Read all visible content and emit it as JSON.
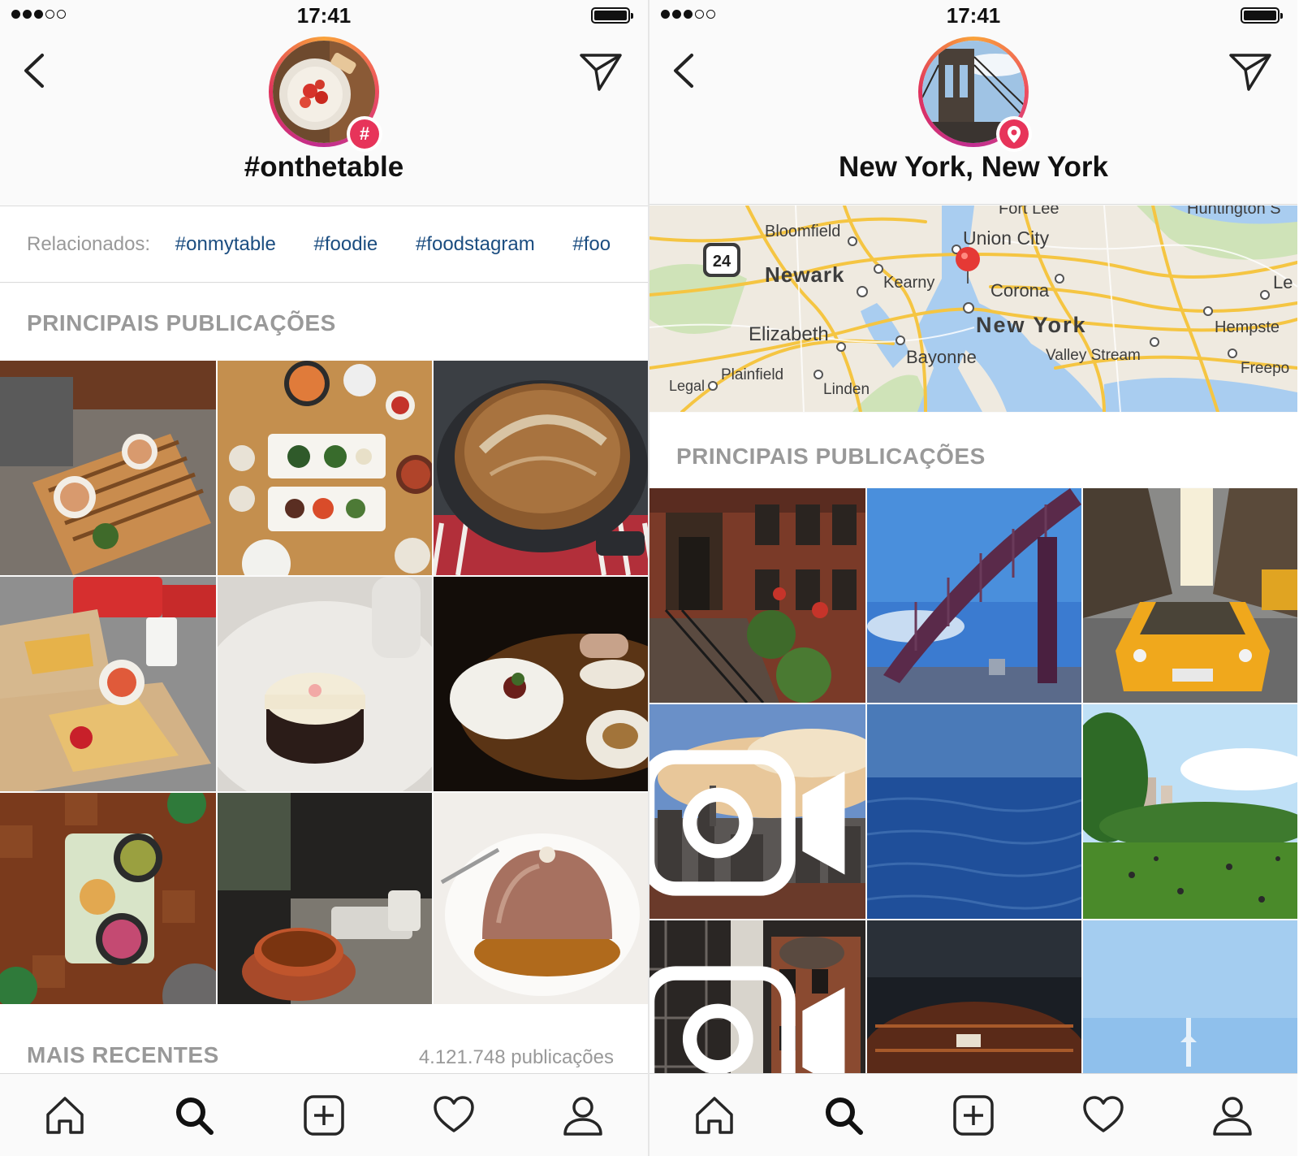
{
  "status_bar": {
    "time": "17:41"
  },
  "left": {
    "header": {
      "title": "#onthetable",
      "badge_symbol": "#"
    },
    "related": {
      "label": "Relacionados:",
      "tags": [
        "#onmytable",
        "#foodie",
        "#foodstagram",
        "#foo"
      ]
    },
    "top_posts": {
      "title": "PRINCIPAIS PUBLICAÇÕES"
    },
    "recent": {
      "title": "MAIS RECENTES",
      "count": "4.121.748 publicações"
    },
    "grid_icons": [
      "noodle-bowls-photo",
      "korean-meal-photo",
      "bread-loaf-photo",
      "grilled-sandwich-photo",
      "cake-photo",
      "plated-dinner-photo",
      "pickles-plate-photo",
      "tea-cup-photo",
      "chocolate-dome-photo"
    ]
  },
  "right": {
    "header": {
      "title": "New York, New York"
    },
    "map": {
      "route_badge": "24",
      "labels": {
        "fort_lee": "Fort Lee",
        "huntington": "Huntington S",
        "bloomfield": "Bloomfield",
        "union_city": "Union City",
        "newark": "Newark",
        "kearny": "Kearny",
        "corona": "Corona",
        "le": "Le",
        "elizabeth": "Elizabeth",
        "new_york": "New York",
        "hempstead": "Hempste",
        "bayonne": "Bayonne",
        "valley_stream": "Valley Stream",
        "plainfield": "Plainfield",
        "freeport": "Freepo",
        "linden": "Linden",
        "legal": "Legal"
      }
    },
    "top_posts": {
      "title": "PRINCIPAIS PUBLICAÇÕES"
    }
  },
  "colors": {
    "hashtag_link": "#1b4d80",
    "badge": "#e7345a",
    "section_gray": "#999999",
    "ring_start": "#f9a33b",
    "ring_end": "#c02e91"
  }
}
